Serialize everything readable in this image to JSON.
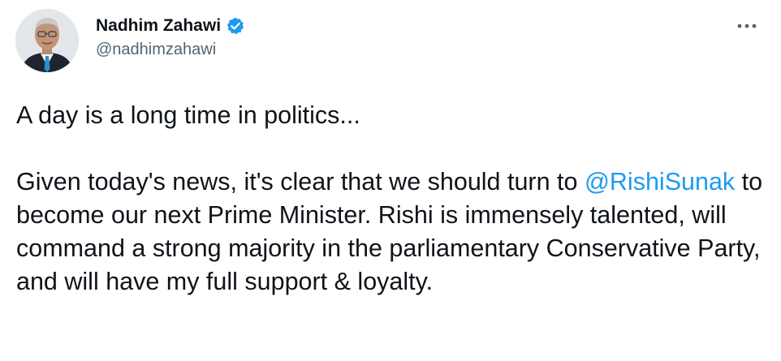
{
  "author": {
    "display_name": "Nadhim Zahawi",
    "handle": "@nadhimzahawi",
    "verified": true
  },
  "menu": {
    "more_icon": "more-horizontal-icon"
  },
  "tweet": {
    "line1": "A day is a long time in politics...",
    "para2_before_mention": "Given today's news, it's clear that we should turn to ",
    "mention": "@RishiSunak",
    "para2_after_mention": " to become our next Prime Minister. Rishi is immensely talented, will command a strong majority in the parliamentary Conservative Party, and will have my full support & loyalty."
  },
  "colors": {
    "text": "#0f1419",
    "secondary": "#536471",
    "accent": "#1d9bf0"
  }
}
